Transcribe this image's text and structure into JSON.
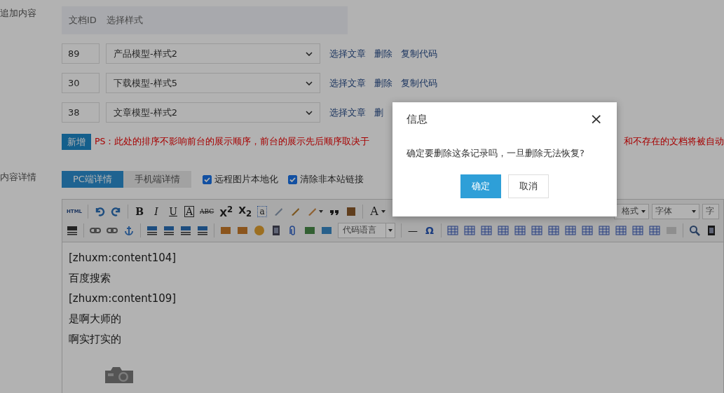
{
  "append_section": {
    "label": "追加内容",
    "header": {
      "id_label": "文档ID",
      "style_label": "选择样式"
    },
    "rows": [
      {
        "id": "89",
        "style": "产品模型-样式2",
        "actions": [
          "选择文章",
          "删除",
          "复制代码"
        ]
      },
      {
        "id": "30",
        "style": "下载模型-样式5",
        "actions": [
          "选择文章",
          "删除",
          "复制代码"
        ]
      },
      {
        "id": "38",
        "style": "文章模型-样式2",
        "actions": [
          "选择文章",
          "删"
        ]
      }
    ],
    "add_button": "新增",
    "note_left": "PS：此处的排序不影响前台的展示顺序，前台的展示先后顺序取决于",
    "note_right": "和不存在的文档将被自动"
  },
  "detail_section": {
    "label": "内容详情",
    "tabs": [
      {
        "label": "PC端详情",
        "selected": true
      },
      {
        "label": "手机端详情",
        "selected": false
      }
    ],
    "options": [
      {
        "label": "远程图片本地化",
        "checked": true
      },
      {
        "label": "清除非本站链接",
        "checked": true
      }
    ]
  },
  "editor": {
    "glyphs": [
      "HTML",
      "B",
      "I",
      "U",
      "A",
      "ABC",
      "X$^{2}$",
      "X$_{2}$",
      "a",
      "A",
      "—",
      "Ω"
    ],
    "dropdowns": [
      "格式",
      "字体",
      "字"
    ],
    "code_language": "代码语言",
    "content": [
      "[zhuxm:content104]",
      "百度搜索",
      "[zhuxm:content109]",
      "是啊大师的",
      "啊实打实的"
    ]
  },
  "dialog": {
    "title": "信息",
    "close": "×",
    "message": "确定要删除这条记录吗，一旦删除无法恢复?",
    "buttons": [
      {
        "label": "确定",
        "kind": "primary"
      },
      {
        "label": "取消",
        "kind": "secondary"
      }
    ]
  }
}
